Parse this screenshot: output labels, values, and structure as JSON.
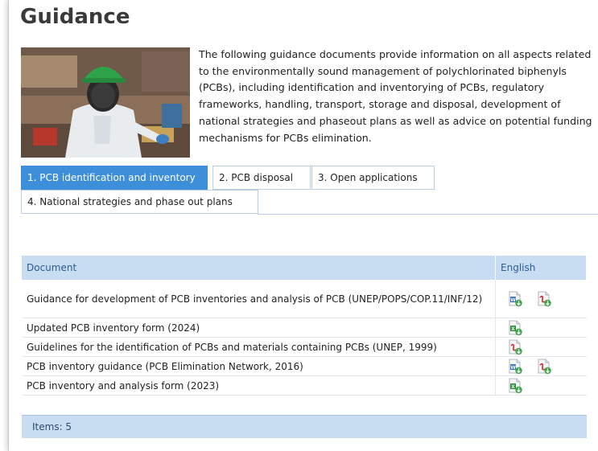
{
  "page": {
    "title": "Guidance",
    "intro": "The following guidance documents provide information on all aspects related to the environmentally sound management of polychlorinated biphenyls (PCBs), including identification and inventorying of PCBs, regulatory frameworks, handling, transport, storage and disposal, development of national strategies and phaseout plans as well as advice on potential funding mechanisms for PCBs elimination."
  },
  "tabs": [
    {
      "label": "1. PCB identification and inventory",
      "active": true
    },
    {
      "label": "2. PCB disposal",
      "active": false
    },
    {
      "label": "3. Open applications",
      "active": false
    },
    {
      "label": "4. National strategies and phase out plans",
      "active": false
    }
  ],
  "table": {
    "headers": {
      "document": "Document",
      "english": "English"
    },
    "rows": [
      {
        "title": "Guidance for development of PCB inventories and analysis of PCB (UNEP/POPS/COP.11/INF/12)",
        "icons": [
          "word-doc-icon",
          "pdf-doc-icon"
        ]
      },
      {
        "title": "Updated PCB inventory form (2024)",
        "icons": [
          "excel-doc-icon"
        ]
      },
      {
        "title": "Guidelines for the identification of PCBs and materials containing PCBs (UNEP, 1999)",
        "icons": [
          "pdf-doc-icon"
        ]
      },
      {
        "title": "PCB inventory guidance (PCB Elimination Network, 2016)",
        "icons": [
          "word-doc-icon",
          "pdf-doc-icon"
        ]
      },
      {
        "title": "PCB inventory and analysis form (2023)",
        "icons": [
          "excel-doc-icon"
        ]
      }
    ],
    "footer": "Items: 5"
  },
  "colors": {
    "active_tab": "#3e8fd9",
    "header_bg": "#c8dcf2",
    "header_text": "#2a5d94",
    "pdf": "#d9262e",
    "word": "#2f6db5",
    "excel": "#2f8a3a"
  }
}
